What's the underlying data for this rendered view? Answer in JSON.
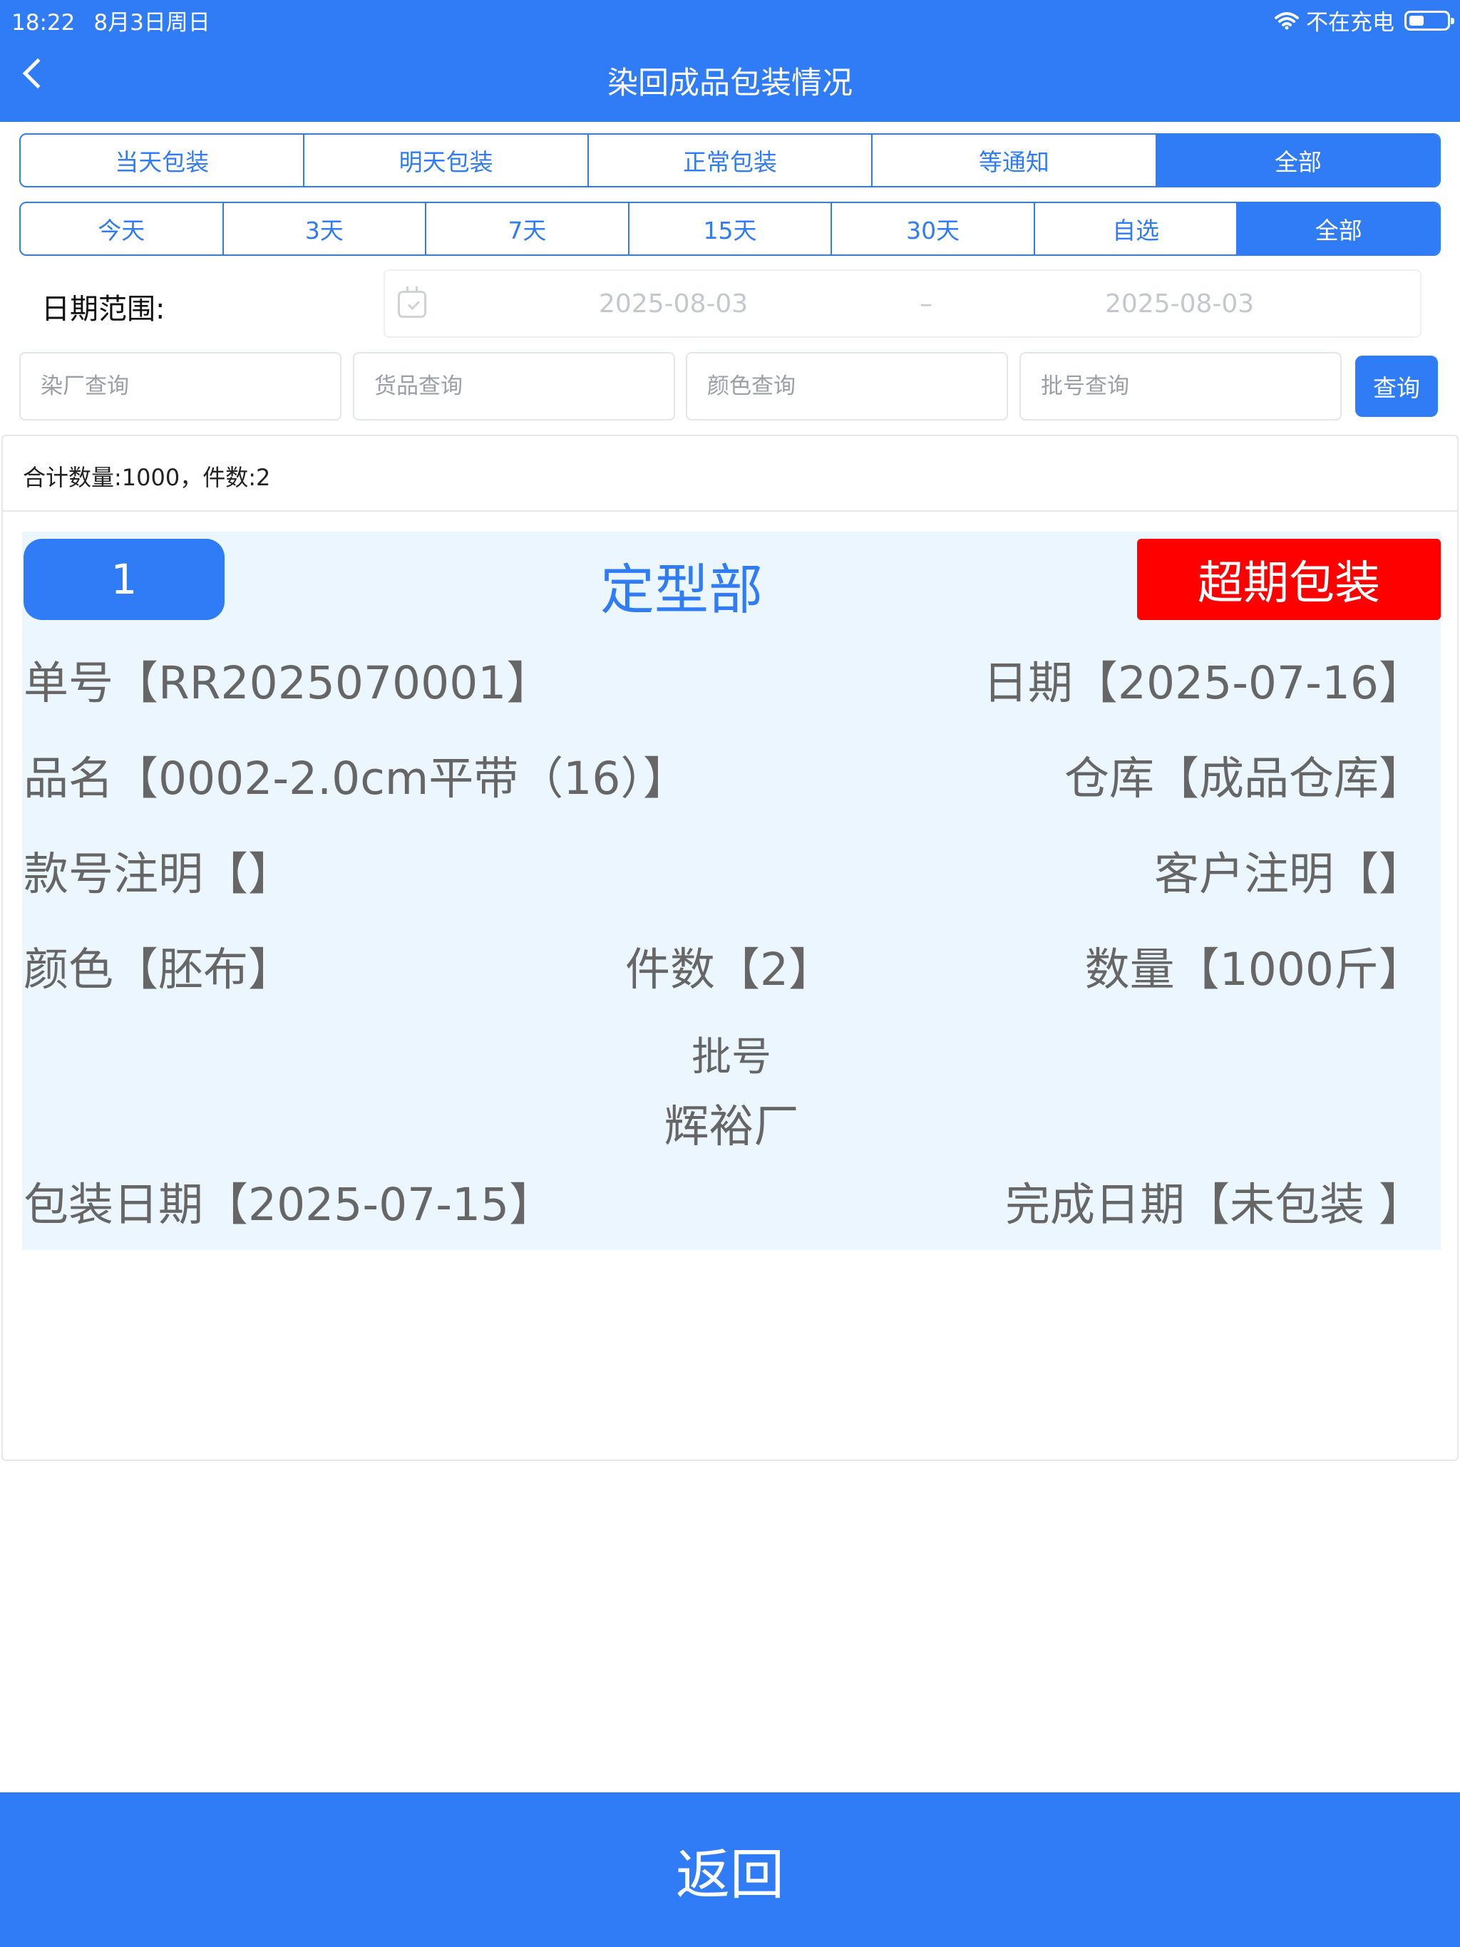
{
  "status_bar": {
    "time": "18:22",
    "date": "8月3日周日",
    "charging": "不在充电",
    "wifi_icon": "wifi-icon",
    "battery_icon": "battery-icon"
  },
  "header": {
    "title": "染回成品包装情况",
    "back_icon": "chevron-left-icon",
    "color": "#2f7cf6"
  },
  "package_tabs": [
    "当天包装",
    "明天包装",
    "正常包装",
    "等通知",
    "全部"
  ],
  "package_tabs_active": "全部",
  "time_tabs": [
    "今天",
    "3天",
    "7天",
    "15天",
    "30天",
    "自选",
    "全部"
  ],
  "time_tabs_active": "全部",
  "date_filter": {
    "label": "日期范围:",
    "start": "2025-08-03",
    "separator": "–",
    "end": "2025-08-03",
    "icon": "calendar-icon"
  },
  "search": {
    "dye_factory_placeholder": "染厂查询",
    "goods_placeholder": "货品查询",
    "color_placeholder": "颜色查询",
    "batch_placeholder": "批号查询",
    "button_label": "查询"
  },
  "summary": "合计数量:1000，件数:2",
  "records": [
    {
      "index": "1",
      "department": "定型部",
      "status": "超期包装",
      "status_color": "#ff0000",
      "order_no": "单号【RR2025070001】",
      "date": "日期【2025-07-16】",
      "product_name": "品名【0002-2.0cm平带（16）】",
      "warehouse": "仓库【成品仓库】",
      "style_note": "款号注明【】",
      "customer_note": "客户注明【】",
      "color": "颜色【胚布】",
      "pieces": "件数【2】",
      "quantity": "数量【1000斤】",
      "batch_label": "批号",
      "factory": "辉裕厂",
      "pack_date": "包装日期【2025-07-15】",
      "finish_date": "完成日期【未包装 】"
    }
  ],
  "footer": {
    "back_label": "返回"
  }
}
